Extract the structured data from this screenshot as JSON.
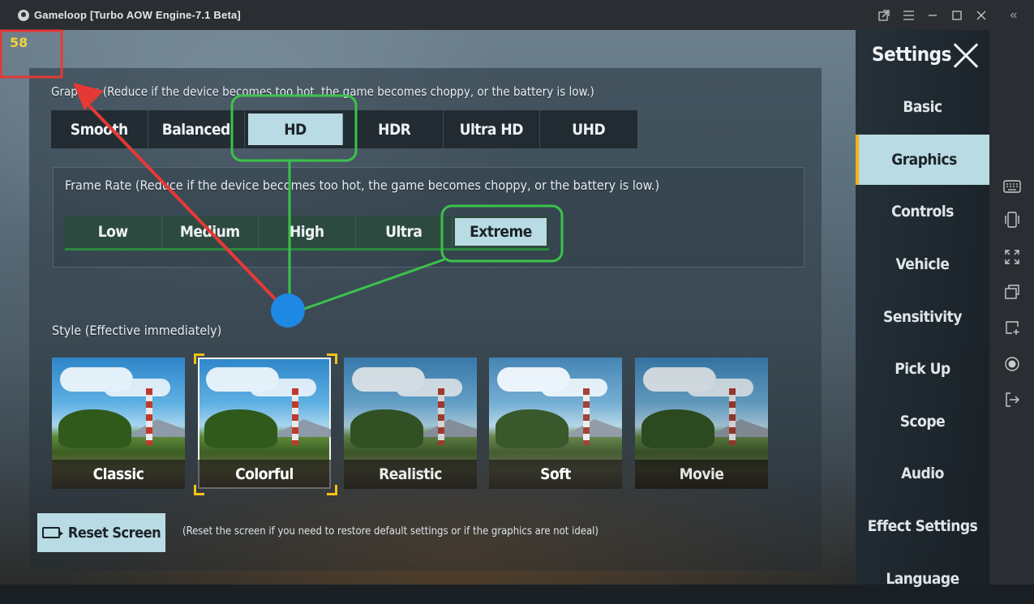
{
  "window": {
    "title": "Gameloop  [Turbo AOW Engine-7.1 Beta]",
    "buttons": [
      "popout-icon",
      "menu-icon",
      "minimize-icon",
      "maximize-icon",
      "close-icon"
    ],
    "collapse_icon": "«"
  },
  "fps": "58",
  "graphics": {
    "label": "Graphics (Reduce if the device becomes too hot, the game becomes choppy, or the battery is low.)",
    "options": [
      "Smooth",
      "Balanced",
      "HD",
      "HDR",
      "Ultra HD",
      "UHD"
    ],
    "selected": "HD"
  },
  "frame_rate": {
    "label": "Frame Rate (Reduce if the device becomes too hot, the game becomes choppy, or the battery is low.)",
    "options": [
      "Low",
      "Medium",
      "High",
      "Ultra",
      "Extreme"
    ],
    "selected": "Extreme"
  },
  "style": {
    "label": "Style (Effective immediately)",
    "options": [
      "Classic",
      "Colorful",
      "Realistic",
      "Soft",
      "Movie"
    ],
    "selected": "Colorful"
  },
  "reset": {
    "label": "Reset Screen",
    "note": "(Reset the screen if you need to restore default settings or if the graphics are not ideal)"
  },
  "settings_menu": {
    "title": "Settings",
    "items": [
      "Basic",
      "Graphics",
      "Controls",
      "Vehicle",
      "Sensitivity",
      "Pick Up",
      "Scope",
      "Audio",
      "Effect Settings",
      "Language"
    ],
    "active": "Graphics"
  },
  "sidebar_icons": [
    "keyboard-icon",
    "shake-icon",
    "fullscreen-icon",
    "multi-window-icon",
    "screenshot-icon",
    "record-icon",
    "exit-icon"
  ],
  "colors": {
    "accent": "#b9dbe3",
    "fps": "#f2d23a",
    "annotation_red": "#e53935",
    "annotation_green": "#3cc24a",
    "annotation_dot": "#1e88e5",
    "active_bar": "#f2b21a"
  }
}
